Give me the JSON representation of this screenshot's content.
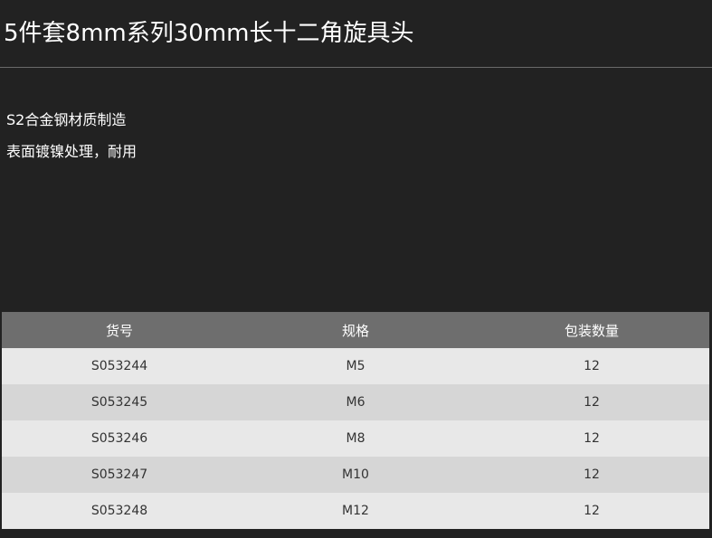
{
  "product": {
    "title": "5件套8mm系列30mm长十二角旋具头"
  },
  "features": [
    "S2合金钢材质制造",
    "表面镀镍处理，耐用"
  ],
  "table": {
    "headers": {
      "code": "货号",
      "spec": "规格",
      "qty": "包装数量"
    },
    "rows": [
      {
        "code": "S053244",
        "spec": "M5",
        "qty": "12"
      },
      {
        "code": "S053245",
        "spec": "M6",
        "qty": "12"
      },
      {
        "code": "S053246",
        "spec": "M8",
        "qty": "12"
      },
      {
        "code": "S053247",
        "spec": "M10",
        "qty": "12"
      },
      {
        "code": "S053248",
        "spec": "M12",
        "qty": "12"
      }
    ]
  },
  "colors": {
    "background": "#222222",
    "header_bg": "#6e6e6e",
    "row_light": "#e8e8e8",
    "row_dark": "#d6d6d6"
  }
}
